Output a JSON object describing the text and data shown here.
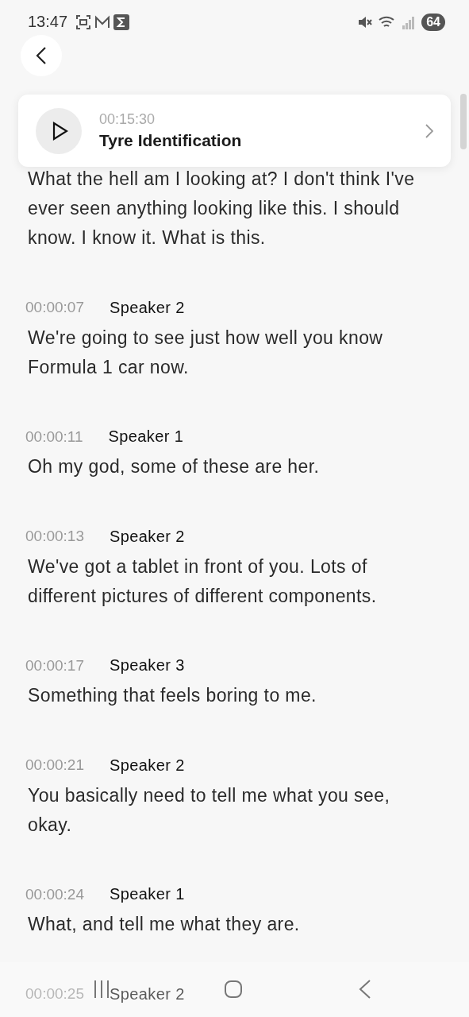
{
  "status_bar": {
    "time": "13:47",
    "battery": "64"
  },
  "player": {
    "time": "00:15:30",
    "title": "Tyre Identification"
  },
  "transcript": [
    {
      "text": "What the hell am I looking at? I don't think I've ever seen anything looking like this. I should know. I know it. What is this."
    },
    {
      "timestamp": "00:00:07",
      "speaker": "Speaker 2",
      "text": "We're going to see just how well you know Formula 1 car now."
    },
    {
      "timestamp": "00:00:11",
      "speaker": "Speaker 1",
      "text": "Oh my god, some of these are her."
    },
    {
      "timestamp": "00:00:13",
      "speaker": "Speaker 2",
      "text": "We've got a tablet in front of you. Lots of different pictures of different components."
    },
    {
      "timestamp": "00:00:17",
      "speaker": "Speaker 3",
      "text": "Something that feels boring to me."
    },
    {
      "timestamp": "00:00:21",
      "speaker": "Speaker 2",
      "text": "You basically need to tell me what you see, okay."
    },
    {
      "timestamp": "00:00:24",
      "speaker": "Speaker 1",
      "text": "What, and tell me what they are."
    },
    {
      "timestamp": "00:00:25",
      "speaker": "Speaker 2"
    }
  ]
}
